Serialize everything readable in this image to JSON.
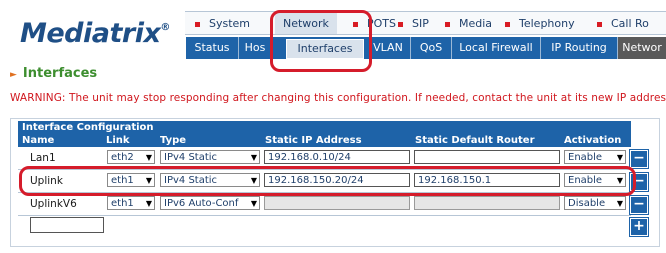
{
  "brand": {
    "name": "Mediatrix",
    "mark": "®"
  },
  "topnav": [
    {
      "label": "System"
    },
    {
      "label": "Network",
      "active": true
    },
    {
      "label": "POTS"
    },
    {
      "label": "SIP"
    },
    {
      "label": "Media"
    },
    {
      "label": "Telephony"
    },
    {
      "label": "Call Ro"
    }
  ],
  "subnav": [
    {
      "label": "Status"
    },
    {
      "label": "Hos"
    },
    {
      "label": "Interfaces",
      "active": true
    },
    {
      "label": "VLAN"
    },
    {
      "label": "QoS"
    },
    {
      "label": "Local Firewall"
    },
    {
      "label": "IP Routing"
    },
    {
      "label": "Networ"
    }
  ],
  "page": {
    "heading": "Interfaces",
    "warning": "WARNING: The unit may stop responding after changing this configuration. If needed, contact the unit at its new IP address."
  },
  "table": {
    "title": "Interface Configuration",
    "columns": {
      "name": "Name",
      "link": "Link",
      "type": "Type",
      "ip": "Static IP Address",
      "router": "Static Default Router",
      "activation": "Activation"
    },
    "rows": [
      {
        "name": "Lan1",
        "link": "eth2",
        "type": "IPv4 Static",
        "ip": "192.168.0.10/24",
        "router": "",
        "activation": "Enable"
      },
      {
        "name": "Uplink",
        "link": "eth1",
        "type": "IPv4 Static",
        "ip": "192.168.150.20/24",
        "router": "192.168.150.1",
        "activation": "Enable"
      },
      {
        "name": "UplinkV6",
        "link": "eth1",
        "type": "IPv6 Auto-Conf",
        "ip": "",
        "router": "",
        "activation": "Disable"
      }
    ],
    "new_name": "",
    "remove_symbol": "−",
    "add_symbol": "+"
  },
  "colors": {
    "accent": "#1e63a8",
    "annotation": "#d51c2b",
    "heading": "#3d8e2f",
    "warning": "#d0161d"
  },
  "icons": {
    "dropdown": "chevron-down-icon",
    "section": "arrow-right-icon"
  }
}
